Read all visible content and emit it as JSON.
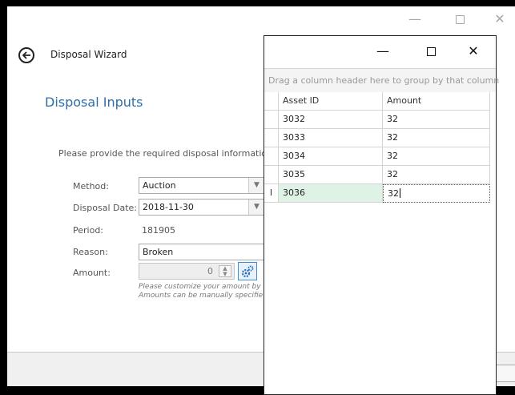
{
  "wizard": {
    "title": "Disposal Wizard",
    "section_title": "Disposal Inputs",
    "instruction": "Please provide the required disposal information i",
    "window_controls": {
      "minimize": "—",
      "close": "✕"
    },
    "fields": {
      "method": {
        "label": "Method:",
        "value": "Auction"
      },
      "disposal_date": {
        "label": "Disposal Date:",
        "value": "2018-11-30"
      },
      "period": {
        "label": "Period:",
        "value": "181905"
      },
      "reason": {
        "label": "Reason:",
        "value": "Broken"
      },
      "amount": {
        "label": "Amount:",
        "value": "0"
      }
    },
    "amount_note_line1": "Please customize your amount by",
    "amount_note_line2": "Amounts can be manually specifie"
  },
  "grid_window": {
    "controls": {
      "minimize": "—",
      "close": "✕"
    },
    "group_panel_hint": "Drag a column header here to group by that column",
    "columns": [
      "Asset ID",
      "Amount"
    ],
    "row_cursor": "I",
    "rows": [
      {
        "asset_id": "3032",
        "amount": "32"
      },
      {
        "asset_id": "3033",
        "amount": "32"
      },
      {
        "asset_id": "3034",
        "amount": "32"
      },
      {
        "asset_id": "3035",
        "amount": "32"
      },
      {
        "asset_id": "3036",
        "amount": "32"
      }
    ],
    "selected_row_index": 4
  },
  "icons": {
    "back": "arrow-left-circle",
    "amount_settings": "gears",
    "dropdown": "chevron-down",
    "spinner": "up-down-arrows"
  },
  "colors": {
    "section_title": "#2e6ea8",
    "selected_cell": "#dff2e6",
    "settings_button_border": "#3f8fd6"
  }
}
